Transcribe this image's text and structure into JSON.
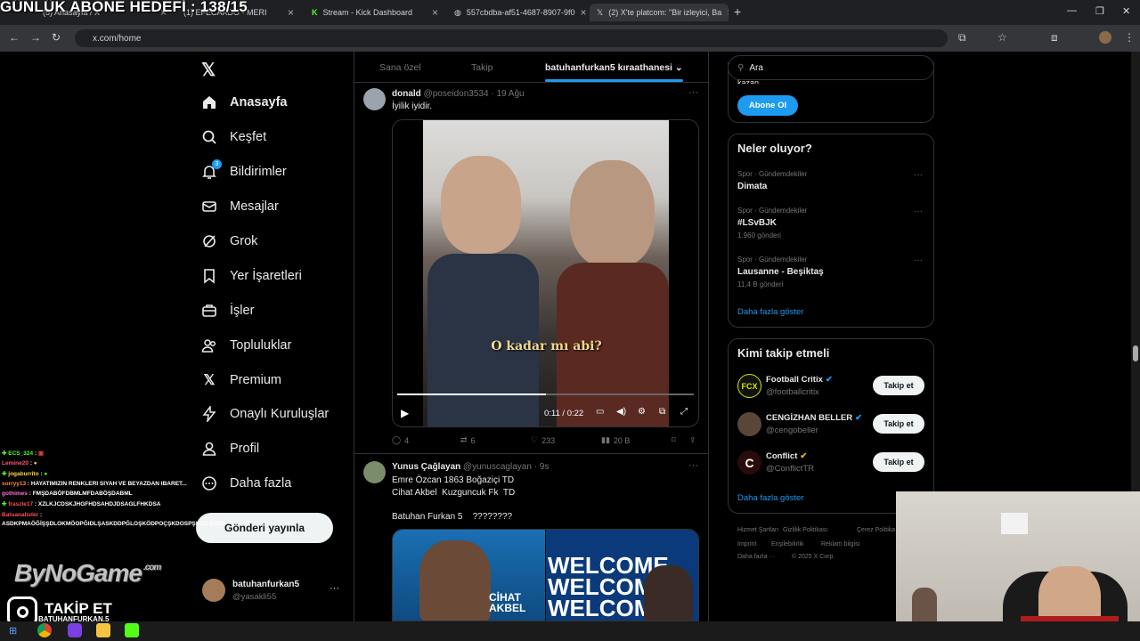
{
  "overlay": {
    "title": "GÜNLÜK ABONE HEDEFİ : 138/15",
    "brand": "ByNoGame",
    "brand_suffix": ".com",
    "follow_label": "TAKİP ET",
    "follow_handle": "BATUHANFURKAN.5"
  },
  "browser": {
    "tabs": [
      {
        "label": "(5) Anasayfa / X"
      },
      {
        "label": "(1) EFECAKDO - MERI"
      },
      {
        "label": "Stream - Kick Dashboard"
      },
      {
        "label": "557cbdba-af51-4687-8907-9f0"
      },
      {
        "label": "(2) X'te platcom: \"Bir izleyici, Ba"
      }
    ],
    "url": "x.com/home"
  },
  "nav": {
    "items": [
      {
        "label": "Anasayfa",
        "icon": "home-icon"
      },
      {
        "label": "Keşfet",
        "icon": "search-icon"
      },
      {
        "label": "Bildirimler",
        "icon": "bell-icon",
        "badge": "3"
      },
      {
        "label": "Mesajlar",
        "icon": "mail-icon"
      },
      {
        "label": "Grok",
        "icon": "grok-icon"
      },
      {
        "label": "Yer İşaretleri",
        "icon": "bookmark-icon"
      },
      {
        "label": "İşler",
        "icon": "briefcase-icon"
      },
      {
        "label": "Topluluklar",
        "icon": "people-icon"
      },
      {
        "label": "Premium",
        "icon": "x-icon"
      },
      {
        "label": "Onaylı Kuruluşlar",
        "icon": "lightning-icon"
      },
      {
        "label": "Profil",
        "icon": "person-icon"
      },
      {
        "label": "Daha fazla",
        "icon": "more-circle-icon"
      }
    ],
    "post_button": "Gönderi yayınla",
    "account": {
      "name": "batuhanfurkan5",
      "handle": "@yasakli55",
      "more": "···"
    }
  },
  "timeline": {
    "tabs": [
      "Sana özel",
      "Takip",
      "batuhanfurkan5 kıraathanesi"
    ],
    "tweets": [
      {
        "name": "donald",
        "handle": "@poseidon3534",
        "time": "· 19 Ağu",
        "text": "İyilik iyidir.",
        "video": {
          "caption": "O kadar mı abi?",
          "time": "0:11 / 0:22",
          "progress": 0.5
        },
        "replies": "4",
        "retweets": "6",
        "likes": "233",
        "views": "20 B"
      },
      {
        "name": "Yunus Çağlayan",
        "handle": "@yunuscaglayan",
        "time": "· 9s",
        "lines": [
          "Emre Özcan 1863 Boğaziçi TD",
          "Cihat Akbel  Kuzguncuk Fk  TD",
          "",
          "Batuhan Furkan 5    ????????"
        ],
        "image_texts": [
          "CİHAT AKBEL",
          "WELCOME",
          "WELCOME",
          "WELCOME"
        ]
      }
    ]
  },
  "right": {
    "search_placeholder": "Ara",
    "subscribe_partial": "kazan.",
    "subscribe_button": "Abone Ol",
    "trends": {
      "title": "Neler oluyor?",
      "items": [
        {
          "category": "Spor · Gündemdekiler",
          "name": "Dimata",
          "count": ""
        },
        {
          "category": "Spor · Gündemdekiler",
          "name": "#LSvBJK",
          "count": "1.960 gönderi"
        },
        {
          "category": "Spor · Gündemdekiler",
          "name": "Lausanne - Beşiktaş",
          "count": "11,4 B gönderi"
        }
      ],
      "more": "Daha fazla göster"
    },
    "follow": {
      "title": "Kimi takip etmeli",
      "items": [
        {
          "name": "Football Critix",
          "handle": "@footballcritix",
          "button": "Takip et"
        },
        {
          "name": "CENGİZHAN BELLER",
          "handle": "@cengobeller",
          "button": "Takip et"
        },
        {
          "name": "Conflict",
          "handle": "@ConflictTR",
          "button": "Takip et"
        }
      ],
      "more": "Daha fazla göster"
    },
    "footer": [
      "Hizmet Şartları",
      "Gizlilik Politikası",
      "Çerez Politika",
      "Imprint",
      "Erişilebilirlik",
      "Reklam bilgisi",
      "Daha fazla ···",
      "© 2025 X Corp."
    ]
  },
  "chat": [
    {
      "user": "ECS_324",
      "msg": ":"
    },
    {
      "user": "Lemine20",
      "msg": ":"
    },
    {
      "user": "jogaburrito",
      "msg": ":"
    },
    {
      "user": "sorryy13",
      "msg": ": HAYATIMIZIN RENKLERI SIYAH VE BEYAZDAN IBARET..."
    },
    {
      "user": "gothimes",
      "msg": ": FMŞDABÖFDBMLMFDABÖŞDABML"
    },
    {
      "user": "fraszle17",
      "msg": ": XZLKJCDSKJHGFHDSAHDJDSAGLFHKDSA"
    },
    {
      "user": "Batuanalister",
      "msg": ": ASDKPMAÖĞİŞŞDLOKMÖOPĞIDLŞASKDDPĞLOŞKÖDPOÇŞKDOSPŞIKDLÖSDS"
    }
  ],
  "colors": {
    "accent": "#1d9bf0",
    "bg": "#000000",
    "border": "#2f3336",
    "muted": "#71767b"
  }
}
